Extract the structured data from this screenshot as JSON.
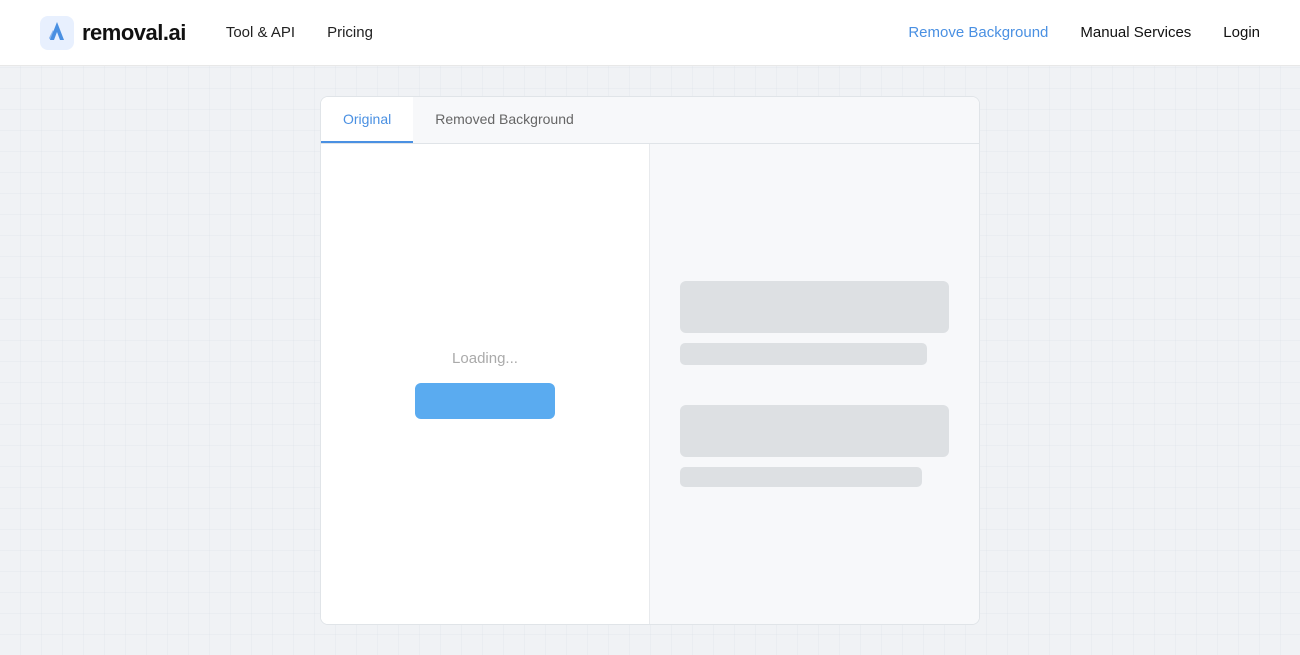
{
  "navbar": {
    "logo_text": "removal.ai",
    "nav_left": [
      {
        "label": "Tool & API",
        "id": "tool-api"
      },
      {
        "label": "Pricing",
        "id": "pricing"
      }
    ],
    "nav_right": [
      {
        "label": "Remove Background",
        "id": "remove-bg",
        "active": true
      },
      {
        "label": "Manual Services",
        "id": "manual-services"
      },
      {
        "label": "Login",
        "id": "login"
      }
    ]
  },
  "card": {
    "tabs": [
      {
        "label": "Original",
        "active": true
      },
      {
        "label": "Removed Background",
        "active": false
      }
    ],
    "left_panel": {
      "loading_text": "Loading..."
    },
    "right_panel": {}
  }
}
